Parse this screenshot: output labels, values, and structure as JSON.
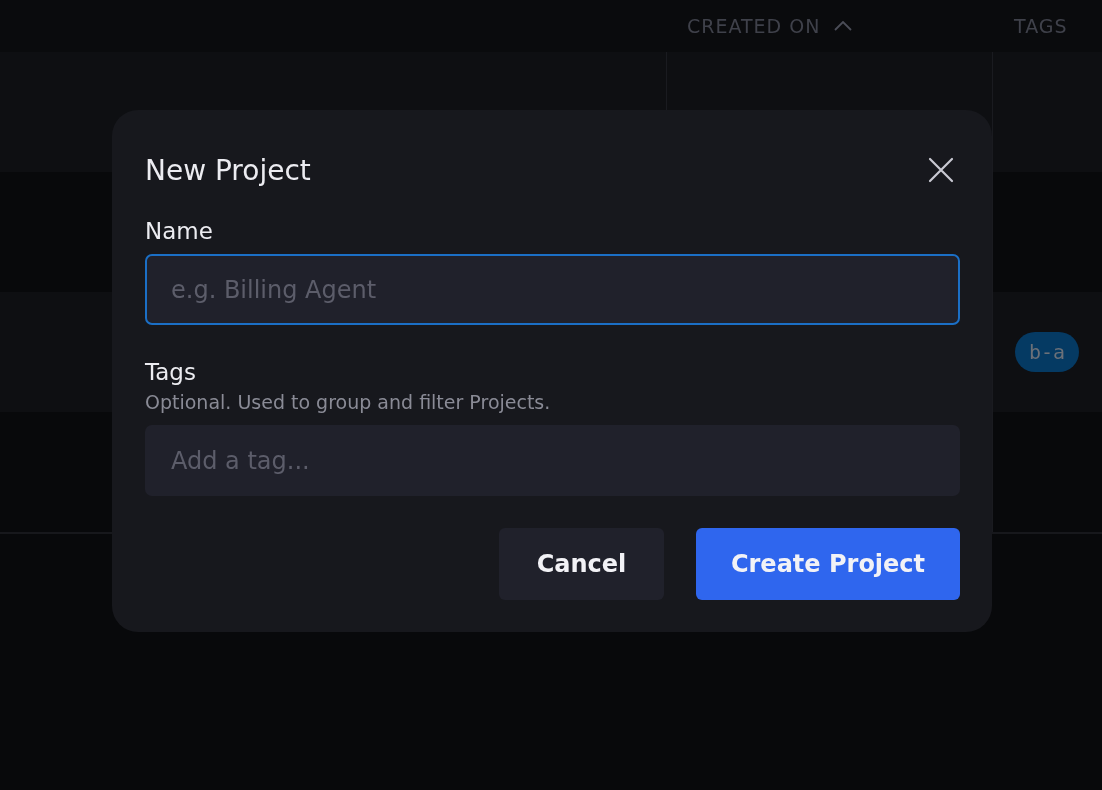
{
  "table": {
    "columns": [
      {
        "label": "CREATED ON",
        "sorted": true
      },
      {
        "label": "TAGS",
        "sorted": false
      }
    ],
    "rows": [
      {
        "tags": []
      },
      {
        "tags": []
      },
      {
        "tags": [
          "b-a"
        ]
      },
      {
        "tags": []
      }
    ]
  },
  "dialog": {
    "title": "New Project",
    "fields": [
      {
        "label": "Name",
        "placeholder": "e.g. Billing Agent",
        "focused": true
      },
      {
        "label": "Tags",
        "hint": "Optional. Used to group and filter Projects.",
        "placeholder": "Add a tag...",
        "focused": false
      }
    ],
    "buttons": [
      {
        "label": "Cancel",
        "kind": "secondary"
      },
      {
        "label": "Create Project",
        "kind": "primary"
      }
    ]
  }
}
